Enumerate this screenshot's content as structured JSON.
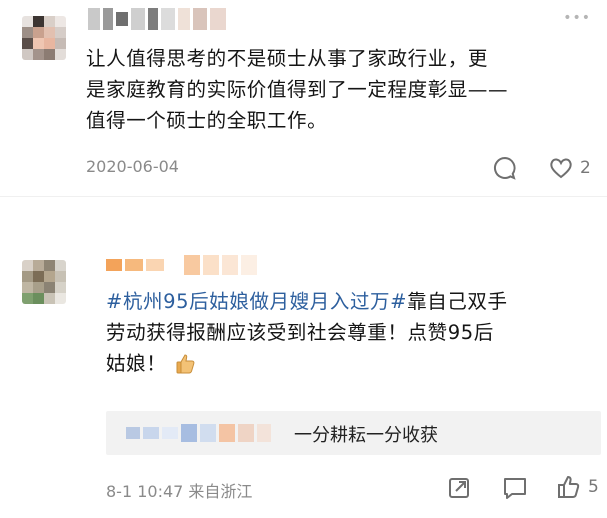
{
  "comment1": {
    "text": "让人值得思考的不是硕士从事了家政行业，更是家庭教育的实际价值得到了一定程度彰显——值得一个硕士的全职工作。",
    "line1": "让人值得思考的不是硕士从事了家政行业，更",
    "line2": "是家庭教育的实际价值得到了一定程度彰显——",
    "line3": "值得一个硕士的全职工作。",
    "date": "2020-06-04",
    "like_count": "2",
    "more_icon": "more-dots-icon",
    "comment_icon": "comment-bubble-icon",
    "like_icon": "heart-icon"
  },
  "comment2": {
    "hashtag": "#杭州95后姑娘做月嫂月入过万#",
    "line1_rest": "靠自己双手",
    "line2": "劳动获得报酬应该受到社会尊重！点赞95后",
    "line3": "姑娘！",
    "emoji_icon": "thumbs-up-emoji-icon",
    "reply_text": "一分耕耘一分收获",
    "meta": "8-1 10:47 来自浙江",
    "like_count": "5",
    "share_icon": "share-icon",
    "comment_icon": "comment-icon",
    "like_icon": "thumbs-up-icon"
  },
  "colors": {
    "hashtag": "#2d5f9e",
    "meta": "#8a8a8a",
    "reply_bg": "#f2f2f2"
  }
}
